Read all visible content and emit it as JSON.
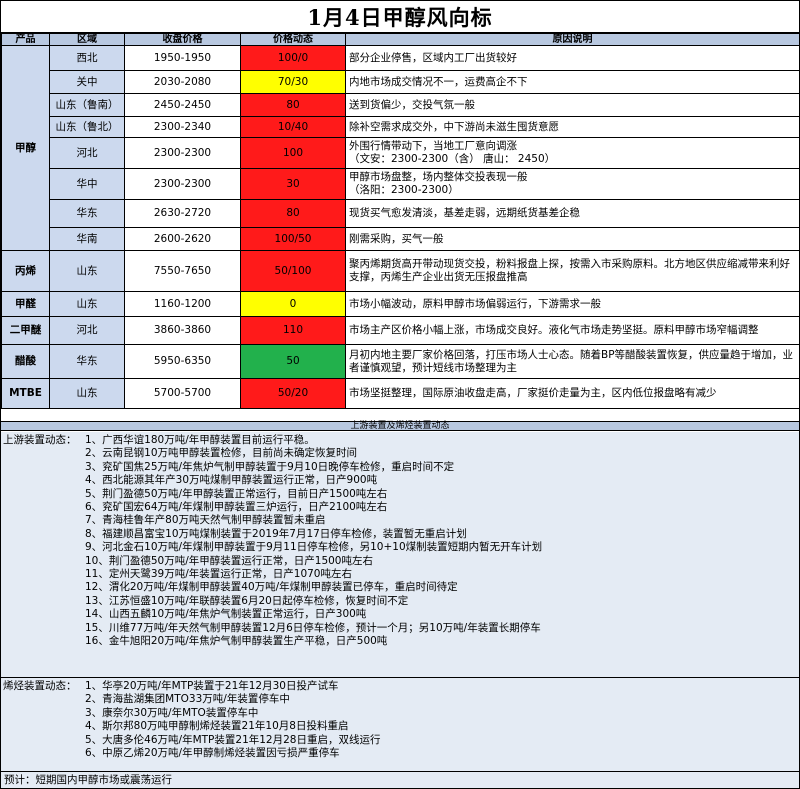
{
  "title": "1月4日甲醇风向标",
  "headers": [
    "产品",
    "区域",
    "收盘价格",
    "价格动态",
    "原因说明"
  ],
  "colors": {
    "red": "#ff1a1a",
    "yellow": "#ffff00",
    "green": "#22b14c",
    "header": "#b8c8e0",
    "cell": "#ccd9ee"
  },
  "products": [
    {
      "name": "甲醇",
      "rows": [
        {
          "region": "西北",
          "price": "1950-1950",
          "change": "100/0",
          "color": "red",
          "reason": "部分企业停售，区域内工厂出货较好"
        },
        {
          "region": "关中",
          "price": "2030-2080",
          "change": "70/30",
          "color": "yellow",
          "reason": "内地市场成交情况不一，运费高企不下"
        },
        {
          "region": "山东（鲁南）",
          "price": "2450-2450",
          "change": "80",
          "color": "red",
          "reason": "送到货偏少，交投气氛一般"
        },
        {
          "region": "山东（鲁北）",
          "price": "2300-2340",
          "change": "10/40",
          "color": "red",
          "reason": "除补空需求成交外，中下游尚未滋生囤货意愿"
        },
        {
          "region": "河北",
          "price": "2300-2300",
          "change": "100",
          "color": "red",
          "reason": "外围行情带动下，当地工厂意向调涨\n（文安：2300-2300（含） 唐山： 2450）"
        },
        {
          "region": "华中",
          "price": "2300-2300",
          "change": "30",
          "color": "red",
          "reason": "甲醇市场盘整，场内整体交投表现一般\n（洛阳：2300-2300）"
        },
        {
          "region": "华东",
          "price": "2630-2720",
          "change": "80",
          "color": "red",
          "reason": "现货买气愈发清淡，基差走弱，远期纸货基差企稳"
        },
        {
          "region": "华南",
          "price": "2600-2620",
          "change": "100/50",
          "color": "red",
          "reason": "刚需采购，买气一般"
        }
      ]
    },
    {
      "name": "丙烯",
      "rows": [
        {
          "region": "山东",
          "price": "7550-7650",
          "change": "50/100",
          "color": "red",
          "reason": "聚丙烯期货高开带动现货交投，粉料报盘上探，按需入市采购原料。北方地区供应缩减带来利好支撑，丙烯生产企业出货无压报盘推高"
        }
      ]
    },
    {
      "name": "甲醛",
      "rows": [
        {
          "region": "山东",
          "price": "1160-1200",
          "change": "0",
          "color": "yellow",
          "reason": "市场小幅波动，原料甲醇市场偏弱运行，下游需求一般"
        }
      ]
    },
    {
      "name": "二甲醚",
      "rows": [
        {
          "region": "河北",
          "price": "3860-3860",
          "change": "110",
          "color": "red",
          "reason": "市场主产区价格小幅上涨，市场成交良好。液化气市场走势坚挺。原料甲醇市场窄幅调整"
        }
      ]
    },
    {
      "name": "醋酸",
      "rows": [
        {
          "region": "华东",
          "price": "5950-6350",
          "change": "50",
          "color": "green",
          "reason": "月初内地主要厂家价格回落，打压市场人士心态。随着BP等醋酸装置恢复，供应量趋于增加，业者谨慎观望，预计短线市场整理为主"
        }
      ]
    },
    {
      "name": "MTBE",
      "rows": [
        {
          "region": "山东",
          "price": "5700-5700",
          "change": "50/20",
          "color": "red",
          "reason": "市场坚挺整理，国际原油收盘走高，厂家挺价走量为主，区内低位报盘略有减少"
        }
      ]
    }
  ],
  "section_title": "上游装置及烯烃装置动态",
  "upstream": {
    "label": "上游装置动态：",
    "items": [
      "1、广西华谊180万吨/年甲醇装置目前运行平稳。",
      "2、云南昆钢10万吨甲醇装置检修，目前尚未确定恢复时间",
      "3、兖矿国焦25万吨/年焦炉气制甲醇装置于9月10日晚停车检修，重启时间不定",
      "4、西北能源其年产30万吨煤制甲醇装置运行正常，日产900吨",
      "5、荆门盈德50万吨/年甲醇装置正常运行，目前日产1500吨左右",
      "6、兖矿国宏64万吨/年煤制甲醇装置三炉运行，日产2100吨左右",
      "7、青海桂鲁年产80万吨天然气制甲醇装置暂未重启",
      "8、福建顺昌富宝10万吨煤制装置于2019年7月17日停车检修，装置暂无重启计划",
      "9、河北金石10万吨/年煤制甲醇装置于9月11日停车检修，另10+10煤制装置短期内暂无开车计划",
      "10、荆门盈德50万吨/年甲醇装置运行正常，日产1500吨左右",
      "11、定州天鹭39万吨/年装置运行正常，日产1070吨左右",
      "12、渭化20万吨/年煤制甲醇装置40万吨/年煤制甲醇装置已停车，重启时间待定",
      "13、江苏恒盛10万吨/年联醇装置6月20日起停车检修，恢复时间不定",
      "14、山西五麟10万吨/年焦炉气制装置正常运行，日产300吨",
      "15、川维77万吨/年天然气制甲醇装置12月6日停车检修，预计一个月；另10万吨/年装置长期停车",
      "16、金牛旭阳20万吨/年焦炉气制甲醇装置生产平稳，日产500吨"
    ]
  },
  "olefin": {
    "label": "烯烃装置动态：",
    "items": [
      "1、华亭20万吨/年MTP装置于21年12月30日投产试车",
      "2、青海盐湖集团MTO33万吨/年装置停车中",
      "3、康奈尔30万吨/年MTO装置停车中",
      "4、斯尔邦80万吨甲醇制烯烃装置21年10月8日投料重启",
      "5、大唐多伦46万吨/年MTP装置21年12月28日重启，双线运行",
      "6、中原乙烯20万吨/年甲醇制烯烃装置因亏损严重停车"
    ]
  },
  "forecast": "预计：短期国内甲醇市场或震荡运行"
}
